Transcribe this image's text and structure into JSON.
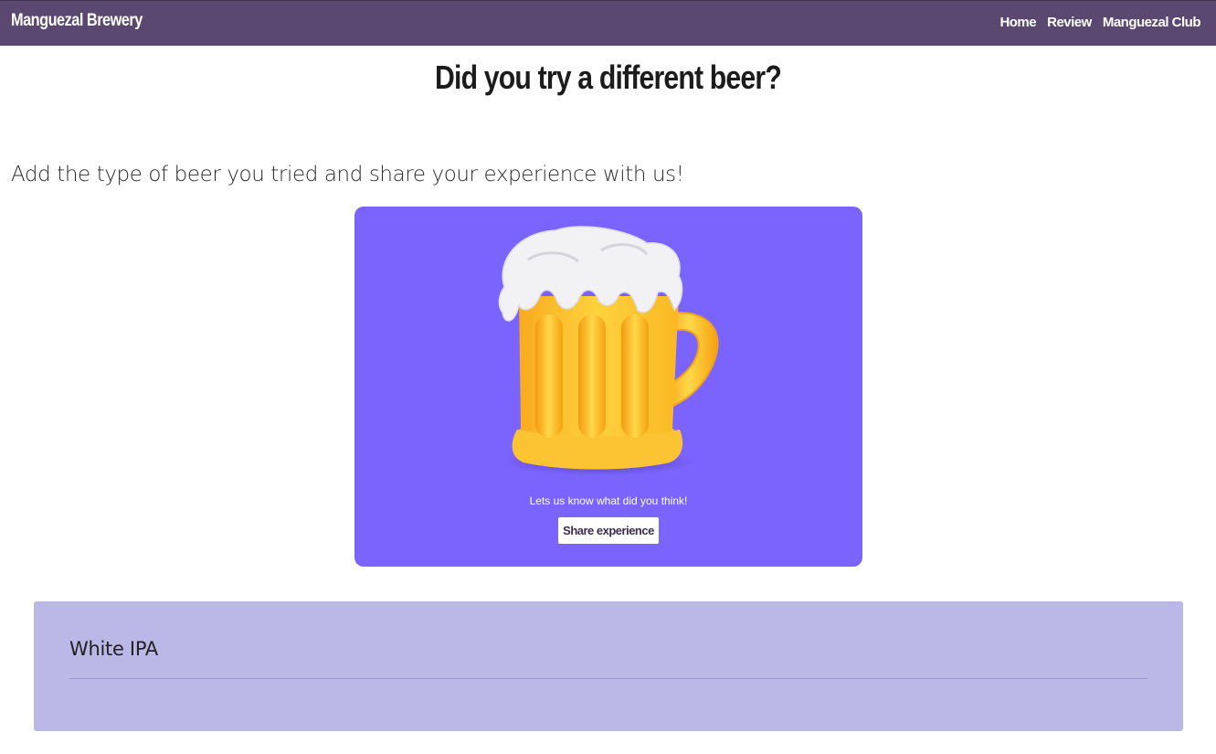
{
  "header": {
    "brand": "Manguezal Brewery",
    "nav": [
      {
        "label": "Home"
      },
      {
        "label": "Review"
      },
      {
        "label": "Manguezal Club"
      }
    ]
  },
  "main": {
    "title": "Did you try a different beer?",
    "intro": "Add the type of beer you tried and share your experience with us!",
    "promo": {
      "image": "beer-mug-icon",
      "text": "Lets us know what did you think!",
      "button_label": "Share experience"
    },
    "reviews": [
      {
        "title": "White IPA"
      }
    ]
  },
  "colors": {
    "navbar": "#5b4870",
    "promo_card": "#7b63fd",
    "review_card": "#bab8e6"
  }
}
